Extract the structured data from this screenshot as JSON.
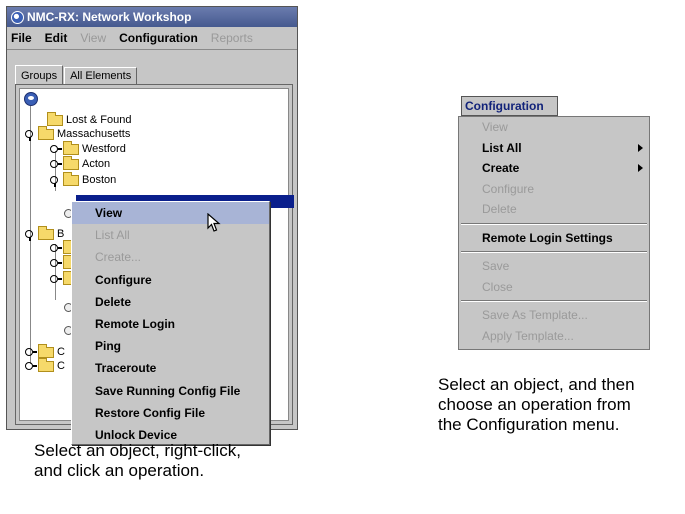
{
  "window": {
    "title": "NMC-RX: Network Workshop",
    "menus": [
      "File",
      "Edit",
      "View",
      "Configuration",
      "Reports"
    ]
  },
  "tabs": [
    "Groups",
    "All Elements"
  ],
  "tree": {
    "lost_found": "Lost & Found",
    "massachusetts": "Massachusetts",
    "westford": "Westford",
    "acton": "Acton",
    "boston": "Boston",
    "partial_b": "B",
    "partial_c1": "C",
    "partial_c2": "C"
  },
  "context_menu": {
    "items": [
      {
        "label": "View",
        "state": "highlighted"
      },
      {
        "label": "List All",
        "state": "disabled"
      },
      {
        "label": "Create...",
        "state": "disabled"
      },
      {
        "label": "Configure",
        "state": "enabled"
      },
      {
        "label": "Delete",
        "state": "enabled"
      },
      {
        "label": "Remote Login",
        "state": "enabled"
      },
      {
        "label": "Ping",
        "state": "enabled"
      },
      {
        "label": "Traceroute",
        "state": "enabled"
      },
      {
        "label": "Save Running Config File",
        "state": "enabled"
      },
      {
        "label": "Restore Config File",
        "state": "enabled"
      },
      {
        "label": "Unlock Device",
        "state": "enabled"
      }
    ]
  },
  "config_menu": {
    "header": "Configuration",
    "items": [
      {
        "label": "View",
        "state": "disabled"
      },
      {
        "label": "List All",
        "state": "enabled",
        "submenu": true
      },
      {
        "label": "Create",
        "state": "enabled",
        "submenu": true
      },
      {
        "label": "Configure",
        "state": "disabled"
      },
      {
        "label": "Delete",
        "state": "disabled"
      },
      {
        "separator": true
      },
      {
        "label": "Remote Login Settings",
        "state": "enabled"
      },
      {
        "separator": true
      },
      {
        "label": "Save",
        "state": "disabled"
      },
      {
        "label": "Close",
        "state": "disabled"
      },
      {
        "separator": true
      },
      {
        "label": "Save As Template...",
        "state": "disabled"
      },
      {
        "label": "Apply Template...",
        "state": "disabled"
      }
    ]
  },
  "captions": {
    "left_line1": "Select an object, right-click,",
    "left_line2": "and click an operation.",
    "right_line1": "Select an object, and then",
    "right_line2": "choose an operation from",
    "right_line3": "the Configuration menu."
  }
}
